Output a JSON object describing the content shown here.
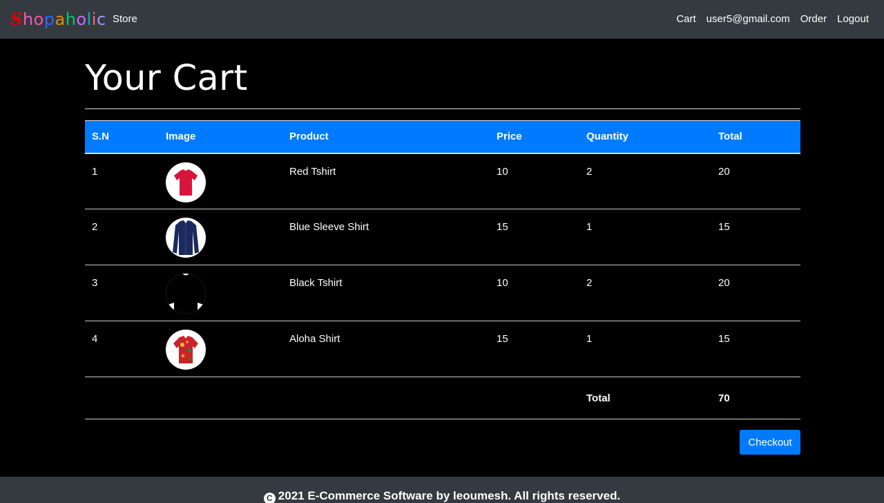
{
  "navbar": {
    "brand_letters": [
      "S",
      "h",
      "o",
      "p",
      "a",
      "h",
      "o",
      "l",
      "i",
      "c"
    ],
    "brand_colors": [
      "#e60000",
      "#e65cb8",
      "#ff4da6",
      "#3366ff",
      "#e68a00",
      "#00cc66",
      "#cc66ff",
      "#00b3b3",
      "#ff6666",
      "#9999ff"
    ],
    "store_label": "Store",
    "right_links": [
      "Cart",
      "user5@gmail.com",
      "Order",
      "Logout"
    ]
  },
  "page": {
    "title": "Your Cart"
  },
  "table": {
    "headers": [
      "S.N",
      "Image",
      "Product",
      "Price",
      "Quantity",
      "Total"
    ],
    "rows": [
      {
        "sn": "1",
        "image": "red-tshirt-icon",
        "product": "Red Tshirt",
        "price": "10",
        "quantity": "2",
        "total": "20"
      },
      {
        "sn": "2",
        "image": "blue-sleeve-shirt-icon",
        "product": "Blue Sleeve Shirt",
        "price": "15",
        "quantity": "1",
        "total": "15"
      },
      {
        "sn": "3",
        "image": "black-tshirt-icon",
        "product": "Black Tshirt",
        "price": "10",
        "quantity": "2",
        "total": "20"
      },
      {
        "sn": "4",
        "image": "aloha-shirt-icon",
        "product": "Aloha Shirt",
        "price": "15",
        "quantity": "1",
        "total": "15"
      }
    ],
    "total_label": "Total",
    "total_value": "70"
  },
  "checkout_label": "Checkout",
  "footer": {
    "text": "2021 E-Commerce Software by leoumesh. All rights reserved."
  },
  "colors": {
    "accent": "#007bff",
    "navbar": "#343a40",
    "background": "#000000"
  }
}
